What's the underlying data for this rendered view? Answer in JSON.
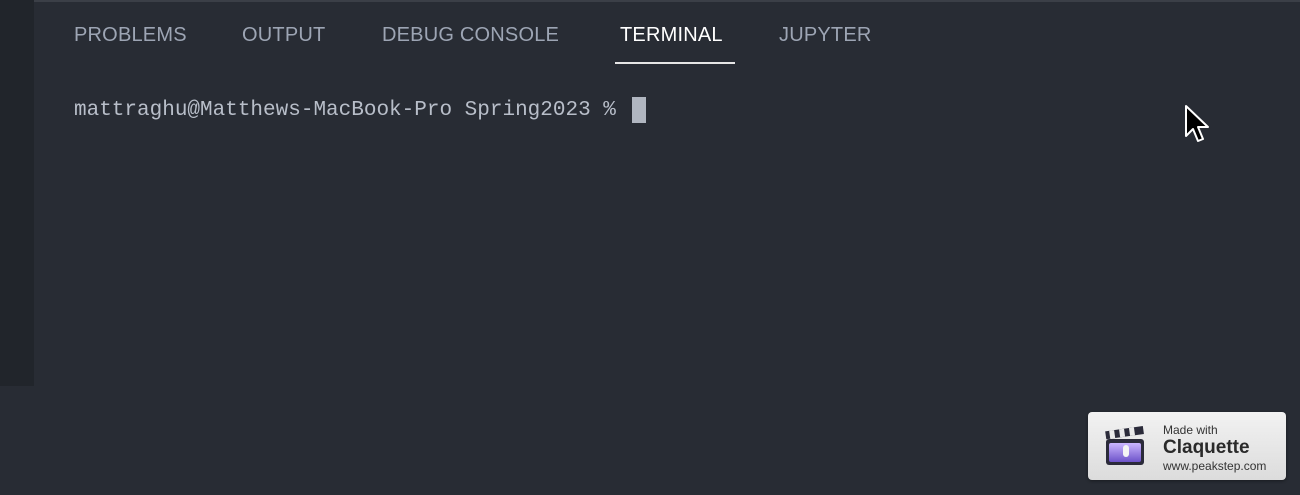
{
  "panel": {
    "tabs": [
      {
        "label": "PROBLEMS",
        "active": false
      },
      {
        "label": "OUTPUT",
        "active": false
      },
      {
        "label": "DEBUG CONSOLE",
        "active": false
      },
      {
        "label": "TERMINAL",
        "active": true
      },
      {
        "label": "JUPYTER",
        "active": false
      }
    ]
  },
  "terminal": {
    "prompt": "mattraghu@Matthews-MacBook-Pro Spring2023 %"
  },
  "watermark": {
    "made_with": "Made with",
    "app_name": "Claquette",
    "url": "www.peakstep.com"
  },
  "icons": {
    "pointer": "mouse-pointer-icon",
    "logo": "clapperboard-icon"
  },
  "colors": {
    "background": "#282c34",
    "activity_bar": "#21252b",
    "tab_inactive": "#9da5b4",
    "tab_active": "#ffffff",
    "terminal_text": "#b8bec9"
  }
}
